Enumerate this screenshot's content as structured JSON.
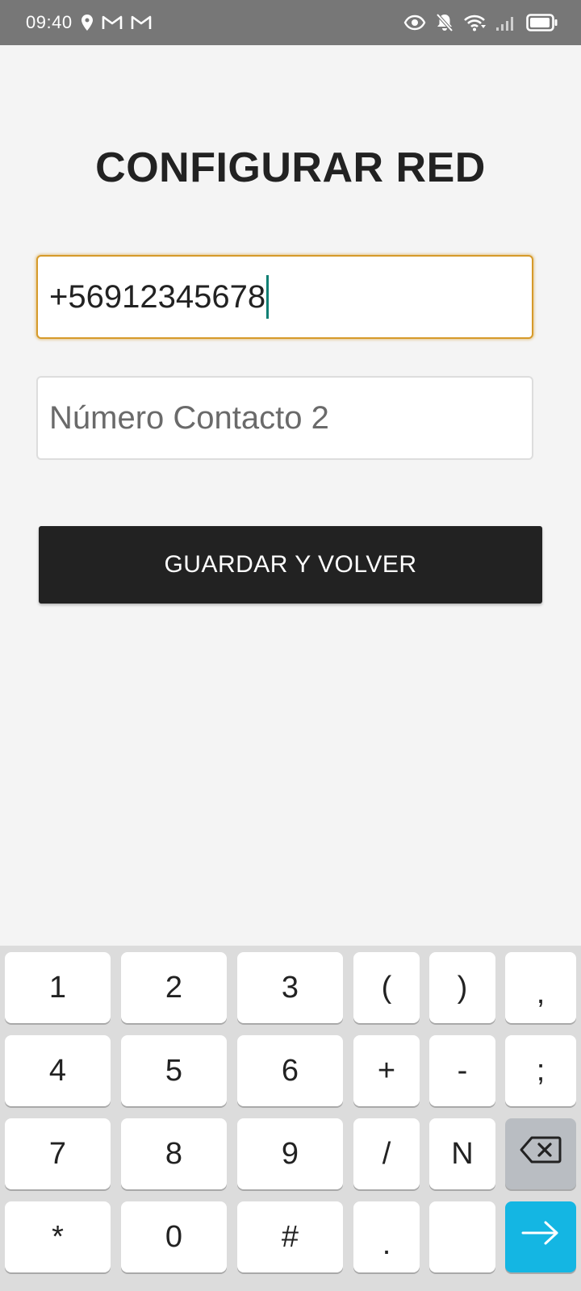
{
  "status_bar": {
    "time": "09:40",
    "icons": [
      "location-icon",
      "gmail-icon",
      "gmail-icon",
      "eye-icon",
      "bell-off-icon",
      "wifi-icon",
      "signal-icon",
      "battery-icon"
    ]
  },
  "page": {
    "title": "CONFIGURAR RED"
  },
  "form": {
    "contact1_value": "+56912345678",
    "contact2_placeholder": "Número Contacto 2",
    "save_label": "GUARDAR Y VOLVER"
  },
  "keyboard": {
    "rows": [
      [
        "1",
        "2",
        "3",
        "(",
        ")",
        ","
      ],
      [
        "4",
        "5",
        "6",
        "+",
        "-",
        ";"
      ],
      [
        "7",
        "8",
        "9",
        "/",
        "N"
      ],
      [
        "*",
        "0",
        "#",
        "."
      ]
    ],
    "special_keys": [
      "backspace-icon",
      "enter-arrow-icon"
    ]
  },
  "colors": {
    "status_bar": "#777777",
    "focus_border": "#d69a2a",
    "caret": "#0d7f73",
    "button_bg": "#222222",
    "enter_key": "#14b6e3"
  }
}
